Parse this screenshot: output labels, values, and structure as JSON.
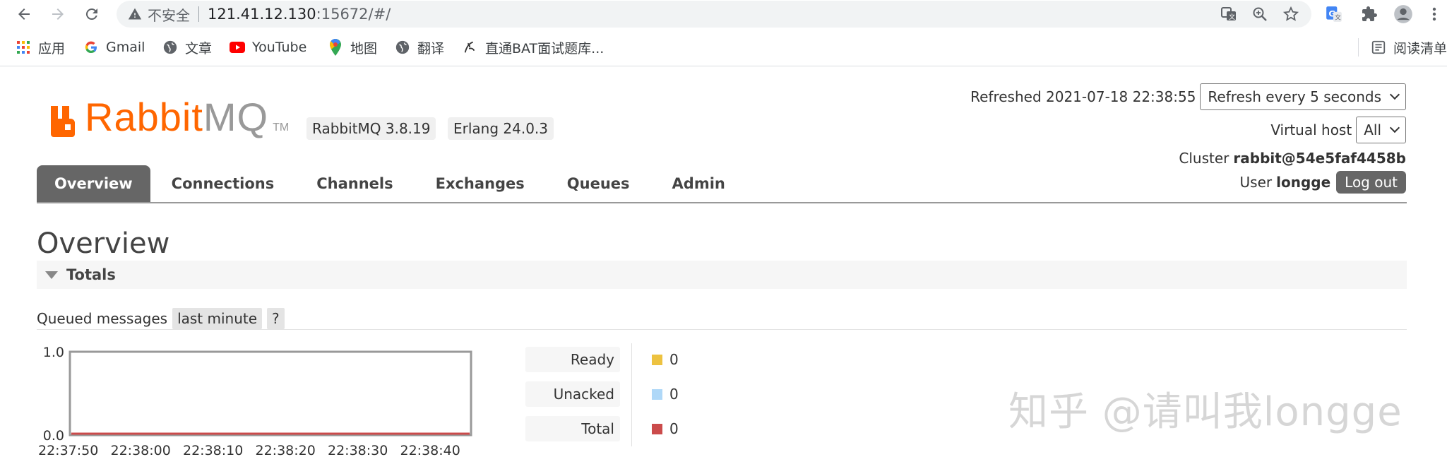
{
  "browser": {
    "address": {
      "insecure_label": "不安全",
      "host": "121.41.12.130",
      "path": ":15672/#/"
    },
    "bookmarks": [
      {
        "label": "应用",
        "icon": "apps-grid-icon"
      },
      {
        "label": "Gmail",
        "icon": "google-icon"
      },
      {
        "label": "文章",
        "icon": "globe-icon"
      },
      {
        "label": "YouTube",
        "icon": "youtube-icon"
      },
      {
        "label": "地图",
        "icon": "maps-pin-icon"
      },
      {
        "label": "翻译",
        "icon": "globe-icon"
      },
      {
        "label": "直通BAT面试题库...",
        "icon": "bookmark-site-icon"
      }
    ],
    "reading_list": "阅读清单"
  },
  "header": {
    "logo_rabbit": "Rabbit",
    "logo_mq": "MQ",
    "logo_tm": "TM",
    "version": "RabbitMQ 3.8.19",
    "erlang": "Erlang 24.0.3",
    "refreshed_label": "Refreshed 2021-07-18 22:38:55",
    "refresh_select": "Refresh every 5 seconds",
    "vhost_label": "Virtual host",
    "vhost_value": "All",
    "cluster_label": "Cluster",
    "cluster_value": "rabbit@54e5faf4458b",
    "user_label": "User",
    "user_value": "longge",
    "logout": "Log out"
  },
  "tabs": [
    "Overview",
    "Connections",
    "Channels",
    "Exchanges",
    "Queues",
    "Admin"
  ],
  "page_title": "Overview",
  "totals": {
    "section_label": "Totals",
    "queued_label": "Queued messages",
    "range_pill": "last minute",
    "help_pill": "?"
  },
  "chart_data": {
    "type": "line",
    "x": [
      "22:37:50",
      "22:38:00",
      "22:38:10",
      "22:38:20",
      "22:38:30",
      "22:38:40"
    ],
    "ylim": [
      0.0,
      1.0
    ],
    "y_tick_labels": [
      "1.0",
      "0.0"
    ],
    "series": [
      {
        "name": "Ready",
        "color": "#edc240",
        "values": [
          0,
          0,
          0,
          0,
          0,
          0
        ]
      },
      {
        "name": "Unacked",
        "color": "#afd8f8",
        "values": [
          0,
          0,
          0,
          0,
          0,
          0
        ]
      },
      {
        "name": "Total",
        "color": "#cb4b4b",
        "values": [
          0,
          0,
          0,
          0,
          0,
          0
        ]
      }
    ]
  },
  "legend": [
    {
      "label": "Ready",
      "value": "0",
      "color": "#edc240"
    },
    {
      "label": "Unacked",
      "value": "0",
      "color": "#afd8f8"
    },
    {
      "label": "Total",
      "value": "0",
      "color": "#cb4b4b"
    }
  ],
  "watermark": "知乎 @请叫我longge"
}
